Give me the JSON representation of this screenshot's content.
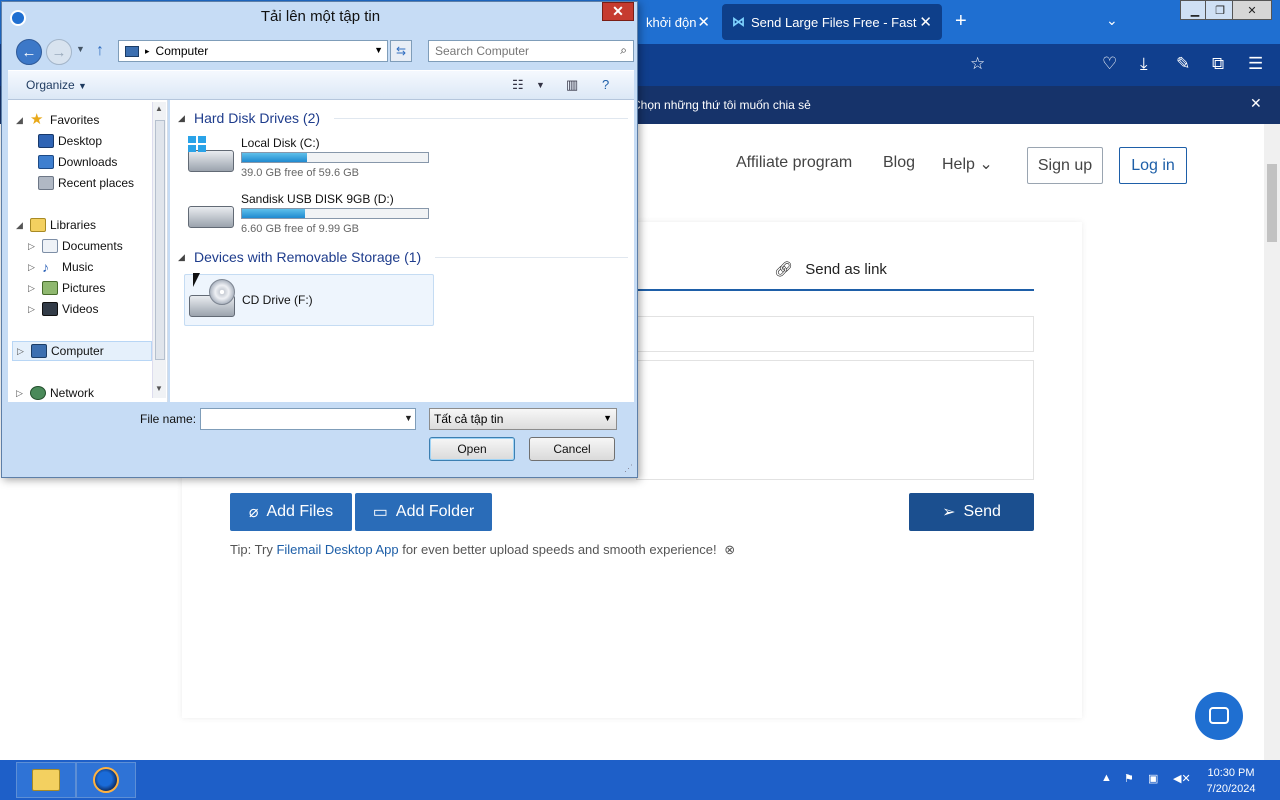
{
  "browser": {
    "tab_inactive_label": "khởi độn",
    "tab_active_label": "Send Large Files Free - Fast Sec",
    "notification_text": "Chọn những thứ tôi muốn chia sẻ"
  },
  "site": {
    "nav": {
      "affiliate": "Affiliate program",
      "blog": "Blog",
      "help": "Help",
      "signup": "Sign up",
      "login": "Log in"
    },
    "send_as_link": "Send as link",
    "add_files": "Add Files",
    "add_folder": "Add Folder",
    "send": "Send",
    "tip_prefix": "Tip: Try ",
    "tip_link": "Filemail Desktop App",
    "tip_suffix": " for even better upload speeds and smooth experience!"
  },
  "dialog": {
    "title": "Tải lên một tập tin",
    "address": "Computer",
    "search_placeholder": "Search Computer",
    "organize": "Organize",
    "nav_tree": {
      "favorites": "Favorites",
      "desktop": "Desktop",
      "downloads": "Downloads",
      "recent": "Recent places",
      "libraries": "Libraries",
      "documents": "Documents",
      "music": "Music",
      "pictures": "Pictures",
      "videos": "Videos",
      "computer": "Computer",
      "network": "Network"
    },
    "groups": {
      "hdd": "Hard Disk Drives (2)",
      "removable": "Devices with Removable Storage (1)"
    },
    "drives": [
      {
        "name": "Local Disk (C:)",
        "free_text": "39.0 GB free of 59.6 GB",
        "used_fraction": 0.35
      },
      {
        "name": "Sandisk USB DISK 9GB (D:)",
        "free_text": "6.60 GB free of 9.99 GB",
        "used_fraction": 0.34
      },
      {
        "name": "CD Drive (F:)"
      }
    ],
    "file_name_label": "File name:",
    "file_name_value": "",
    "filter": "Tất cả tập tin",
    "open": "Open",
    "cancel": "Cancel"
  },
  "taskbar": {
    "time": "10:30 PM",
    "date": "7/20/2024"
  }
}
